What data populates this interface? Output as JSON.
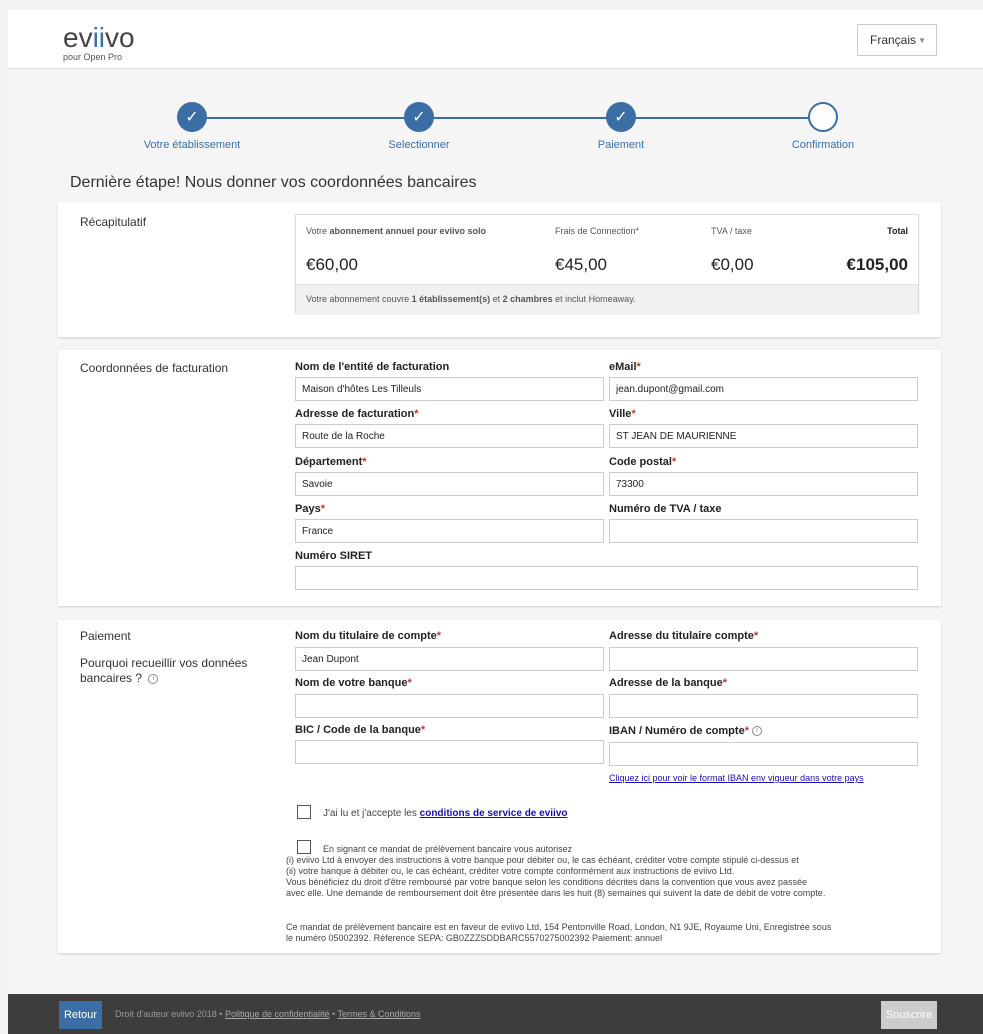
{
  "header": {
    "logo_text_left": "ev",
    "logo_text_accent": "ii",
    "logo_text_right": "vo",
    "logo_subtitle": "pour Open Pro",
    "language": "Français"
  },
  "stepper": {
    "steps": [
      {
        "label": "Votre établissement",
        "state": "done"
      },
      {
        "label": "Selectionner",
        "state": "done"
      },
      {
        "label": "Paiement",
        "state": "done"
      },
      {
        "label": "Confirmation",
        "state": "current"
      }
    ],
    "check_glyph": "✓"
  },
  "page_heading": "Dernière étape! Nous donner vos coordonnées bancaires",
  "summary": {
    "section_title": "Récapitulatif",
    "plan_label_prefix": "Votre ",
    "plan_label_bold": "abonnement annuel pour eviivo solo",
    "plan_value": "€60,00",
    "connection_label": "Frais de Connection*",
    "connection_value": "€45,00",
    "tax_label": "TVA / taxe",
    "tax_value": "€0,00",
    "total_label": "Total",
    "total_value": "€105,00",
    "foot_prefix": "Votre abonnement couvre ",
    "foot_bold1": "1 établissement(s)",
    "foot_mid": " et ",
    "foot_bold2": "2 chambres",
    "foot_suffix": " et inclut Homeaway."
  },
  "billing": {
    "section_title": "Coordonnées de facturation",
    "entity_label": "Nom de l'entité de facturation",
    "entity_value": "Maison d'hôtes Les Tilleuls",
    "email_label": "eMail",
    "email_value": "jean.dupont@gmail.com",
    "address_label": "Adresse de facturation",
    "address_value": "Route de la Roche",
    "city_label": "Ville",
    "city_value": "ST JEAN DE MAURIENNE",
    "department_label": "Département",
    "department_value": "Savoie",
    "postal_label": "Code postal",
    "postal_value": "73300",
    "country_label": "Pays",
    "country_value": "France",
    "vat_label": "Numéro de TVA / taxe",
    "vat_value": "",
    "siret_label": "Numéro SIRET",
    "siret_value": ""
  },
  "payment": {
    "section_title": "Paiement",
    "why_text": "Pourquoi recueillir vos données bancaires ?",
    "holder_label": "Nom du titulaire de compte",
    "holder_value": "Jean Dupont",
    "holder_address_label": "Adresse du titulaire compte",
    "holder_address_value": "",
    "bank_name_label": "Nom de votre banque",
    "bank_name_value": "",
    "bank_address_label": "Adresse de la banque",
    "bank_address_value": "",
    "bic_label": "BIC / Code de la banque",
    "bic_value": "",
    "iban_label": "IBAN / Numéro de compte",
    "iban_value": "",
    "iban_link": "Cliquez ici pour voir le format IBAN env vigueur dans votre pays",
    "terms_prefix": "J'ai lu et j'accepte les ",
    "terms_link": "conditions de service de eviivo",
    "mandate_line1": "En signant ce mandat de prélèvement bancaire vous autorisez",
    "mandate_line2": "(i) eviivo Ltd à envoyer des instructions à votre banque pour débiter ou, le cas échéant, créditer votre compte stipulé ci-dessus et",
    "mandate_line3": "(ii) votre banque à débiter ou, le cas échéant, créditer votre compte conformément aux instructions de eviivo Ltd.",
    "mandate_line4": "Vous bénéficiez du droit d'être remboursé par votre banque selon les conditions décrites dans la convention que vous avez passée",
    "mandate_line5": "avec elle. Une demande de remboursement doit être présentée dans les huit (8) semaines qui suivent la date de débit de votre compte.",
    "mandate_line6": "Ce mandat de prélèvement bancaire est en faveur de eviivo Ltd, 154 Pentonville Road, London, N1 9JE, Royaume Uni, Enregistrée sous",
    "mandate_line7": "le numéro 05002392. Réference SEPA: GB0ZZZSDDBARC5570275002392 Paiement: annuel"
  },
  "footer": {
    "back_label": "Retour",
    "copyright_prefix": "Droit d'auteur eviivo 2018 • ",
    "privacy_link": "Politique de confidentialité",
    "separator": " • ",
    "terms_link": "Termes & Conditions",
    "submit_label": "Souscrire"
  },
  "info_glyph": "i",
  "required_mark": "*",
  "colors": {
    "accent": "#3a6ea5",
    "required": "#c0392b",
    "footer_bg": "#3d3d3d",
    "link": "#1a0dab"
  }
}
